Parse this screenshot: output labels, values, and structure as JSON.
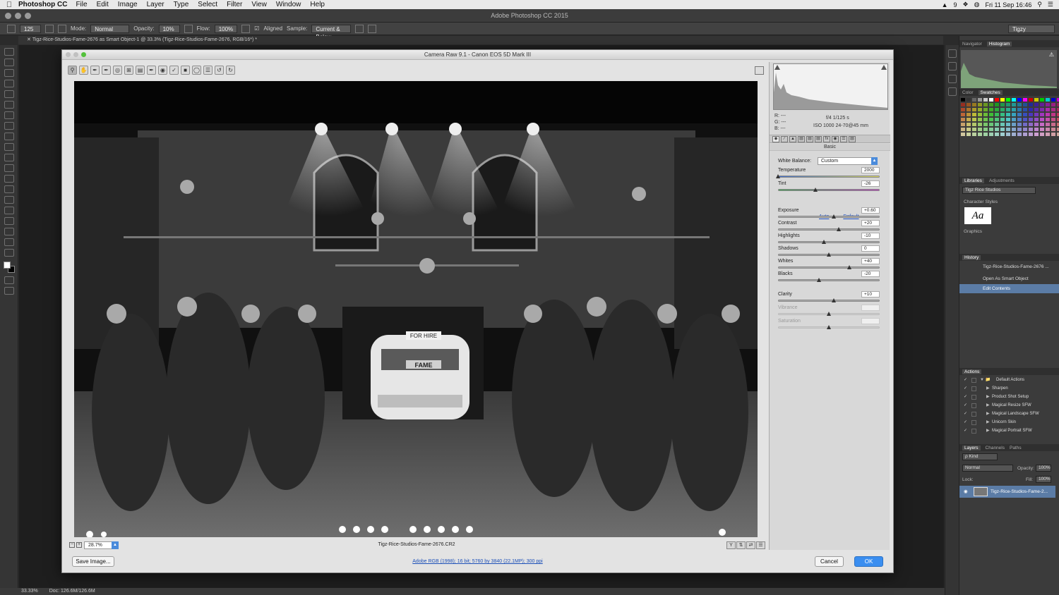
{
  "menubar": {
    "app_name": "Photoshop CC",
    "items": [
      "File",
      "Edit",
      "Image",
      "Layer",
      "Type",
      "Select",
      "Filter",
      "View",
      "Window",
      "Help"
    ],
    "status_notifications": "9",
    "clock": "Fri 11 Sep  16:46"
  },
  "window_title": "Adobe Photoshop CC 2015",
  "options_bar": {
    "brush_size": "125",
    "mode_label": "Mode:",
    "mode_value": "Normal",
    "opacity_label": "Opacity:",
    "opacity_value": "10%",
    "flow_label": "Flow:",
    "flow_value": "100%",
    "aligned_label": "Aligned",
    "sample_label": "Sample:",
    "sample_value": "Current & Below",
    "workspace": "Tigzy"
  },
  "document_tab": "Tigz-Rice-Studios-Fame-2676 as Smart Object-1 @ 33.3% (Tigz-Rice-Studios-Fame-2676, RGB/16*) *",
  "status_bar": {
    "zoom": "33.33%",
    "doc_size": "Doc: 126.6M/126.6M"
  },
  "camera_raw": {
    "title": "Camera Raw 9.1  -  Canon EOS 5D Mark III",
    "zoom": "28.7%",
    "filename": "Tigz-Rice-Studios-Fame-2676.CR2",
    "workflow_link": "Adobe RGB (1998); 16 bit; 5760 by 3840 (22.1MP); 300 ppi",
    "save_button": "Save Image...",
    "cancel_button": "Cancel",
    "ok_button": "OK",
    "readout": {
      "r": "R:  ---",
      "g": "G:  ---",
      "b": "B:  ---",
      "aperture_shutter": "f/4   1/125 s",
      "iso_lens": "ISO 1000   24-70@45 mm"
    },
    "panel_title": "Basic",
    "white_balance_label": "White Balance:",
    "white_balance_value": "Custom",
    "auto_label": "Auto",
    "default_label": "Default",
    "sliders": [
      {
        "name": "Temperature",
        "value": "2000",
        "pos": 0.0,
        "track": "temp"
      },
      {
        "name": "Tint",
        "value": "-26",
        "pos": 0.37,
        "track": "tint"
      },
      {
        "name": "Exposure",
        "value": "+0.60",
        "pos": 0.55,
        "track": "grey"
      },
      {
        "name": "Contrast",
        "value": "+20",
        "pos": 0.6,
        "track": "grey"
      },
      {
        "name": "Highlights",
        "value": "-10",
        "pos": 0.45,
        "track": "grey"
      },
      {
        "name": "Shadows",
        "value": "0",
        "pos": 0.5,
        "track": "grey"
      },
      {
        "name": "Whites",
        "value": "+40",
        "pos": 0.7,
        "track": "grey"
      },
      {
        "name": "Blacks",
        "value": "-20",
        "pos": 0.4,
        "track": "grey"
      },
      {
        "name": "Clarity",
        "value": "+10",
        "pos": 0.55,
        "track": "grey"
      },
      {
        "name": "Vibrance",
        "value": "",
        "pos": 0.5,
        "track": "disabled"
      },
      {
        "name": "Saturation",
        "value": "",
        "pos": 0.5,
        "track": "disabled"
      }
    ],
    "preview_signs": {
      "sign1": "FOR HIRE",
      "sign2": "FAME"
    }
  },
  "panels": {
    "navigator_tab": "Navigator",
    "histogram_tab": "Histogram",
    "color_tab": "Color",
    "swatches_tab": "Swatches",
    "libraries_tab": "Libraries",
    "adjustments_tab": "Adjustments",
    "library_name": "Tigz Rice Studios",
    "character_styles": "Character Styles",
    "aa_sample": "Aa",
    "graphics": "Graphics",
    "history_tab": "History",
    "history_items": [
      "Tigz-Rice-Studios-Fame-2676 ...",
      "Open As Smart Object",
      "Edit Contents"
    ],
    "actions_tab": "Actions",
    "actions": [
      "Default Actions",
      "Sharpen",
      "Product Shot Setup",
      "Magical Resize SFW",
      "Magical Landscape SFW",
      "Unicorn Skin",
      "Magical Portrait SFW"
    ],
    "layers_tab": "Layers",
    "channels_tab": "Channels",
    "paths_tab": "Paths",
    "kind_label": "ρ Kind",
    "blend_mode": "Normal",
    "opacity_label": "Opacity:",
    "opacity_value": "100%",
    "lock_label": "Lock:",
    "fill_label": "Fill:",
    "fill_value": "100%",
    "layer_name": "Tigz-Rice-Studios-Fame-2..."
  }
}
